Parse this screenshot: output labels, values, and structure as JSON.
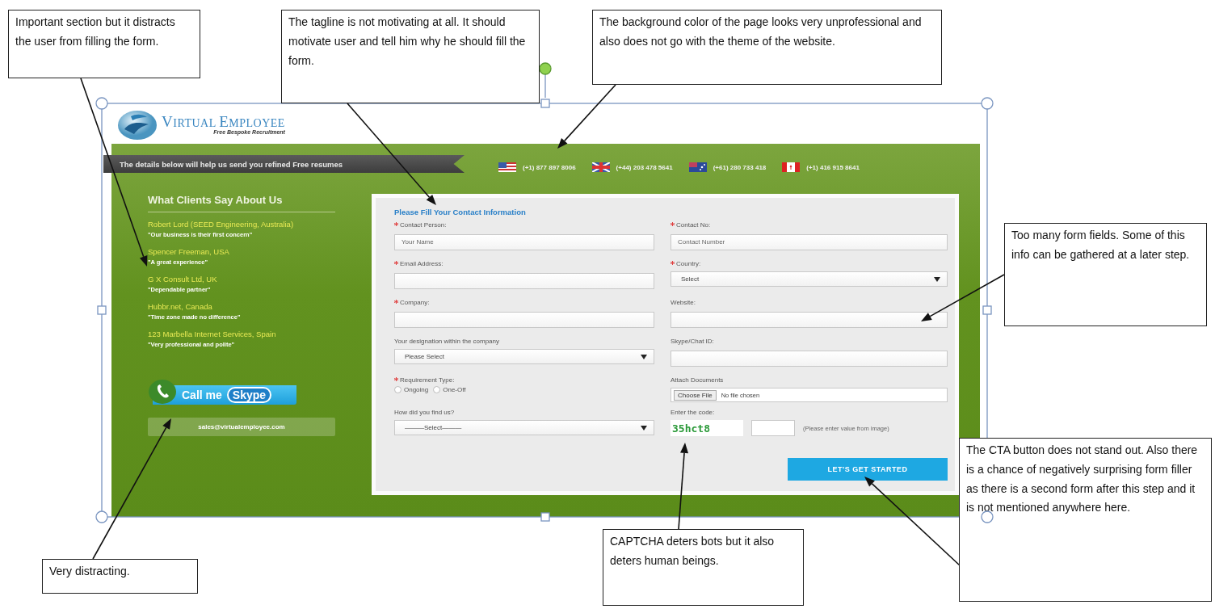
{
  "website": {
    "logo": {
      "name": "VIRTUAL EMPLOYEE",
      "tagline": "Free Bespoke Recruitment"
    },
    "banner": "The details below will help us send you refined Free resumes",
    "phones": [
      {
        "kind": "us",
        "number": "(+1) 877 897 8006"
      },
      {
        "kind": "uk",
        "number": "(+44) 203 478 5641"
      },
      {
        "kind": "au",
        "number": "(+61) 280 733 418"
      },
      {
        "kind": "ca",
        "number": "(+1) 416 915 8641"
      }
    ],
    "testimonials": {
      "heading": "What Clients Say About Us",
      "items": [
        {
          "client": "Robert Lord (SEED Engineering, Australia)",
          "quote": "\"Our business is their first concern\""
        },
        {
          "client": "Spencer Freeman, USA",
          "quote": "\"A great experience\""
        },
        {
          "client": "G X Consult Ltd, UK",
          "quote": "\"Dependable partner\""
        },
        {
          "client": "Hubbr.net, Canada",
          "quote": "\"Time zone made no difference\""
        },
        {
          "client": "123 Marbella Internet Services, Spain",
          "quote": "\"Very professional and polite\""
        }
      ]
    },
    "skype_button": {
      "label": "Call me",
      "brand": "Skype"
    },
    "email": "sales@virtualemployee.com",
    "form": {
      "title": "Please Fill Your Contact Information",
      "left_fields": [
        {
          "kind": "text",
          "label": "Contact Person:",
          "required": true,
          "placeholder": "Your Name"
        },
        {
          "kind": "text",
          "label": "Email Address:",
          "required": true
        },
        {
          "kind": "text",
          "label": "Company:",
          "required": true
        },
        {
          "kind": "select",
          "label": "Your designation within the company",
          "required": false,
          "value": "Please Select"
        },
        {
          "kind": "radio",
          "label": "Requirement Type:",
          "required": true,
          "options": [
            {
              "label": "Ongoing",
              "selected": false
            },
            {
              "label": "One-Off",
              "selected": false
            }
          ]
        },
        {
          "kind": "select",
          "label": "How did you find us?",
          "required": false,
          "value": "———Select———"
        }
      ],
      "right_fields": [
        {
          "kind": "text",
          "label": "Contact No:",
          "required": true,
          "placeholder": "Contact Number"
        },
        {
          "kind": "select",
          "label": "Country:",
          "required": true,
          "value": "Select"
        },
        {
          "kind": "text",
          "label": "Website:",
          "required": false
        },
        {
          "kind": "text",
          "label": "Skype/Chat ID:",
          "required": false
        },
        {
          "kind": "file",
          "label": "Attach Documents",
          "required": false,
          "button": "Choose File",
          "status": "No file chosen"
        },
        {
          "kind": "captcha",
          "label": "Enter the code:",
          "required": false,
          "code": "35hct8",
          "hint": "(Please enter value from image)"
        }
      ],
      "submit": "LET'S GET STARTED"
    }
  },
  "annotations": [
    {
      "text": "Important section but it distracts the user from filling the form."
    },
    {
      "text": "The tagline is not motivating at all. It should motivate user and tell him why he should fill the form."
    },
    {
      "text": "The background color of the page looks very unprofessional and also does not go with the theme of the website."
    },
    {
      "text": "Too many form fields. Some of this info can be gathered at a later step."
    },
    {
      "text": "The CTA button does not stand out. Also there is a chance of negatively surprising form filler as there is a second form after this step and it is not mentioned anywhere here."
    },
    {
      "text": "CAPTCHA deters bots but it also deters human beings."
    },
    {
      "text": "Very distracting."
    }
  ]
}
